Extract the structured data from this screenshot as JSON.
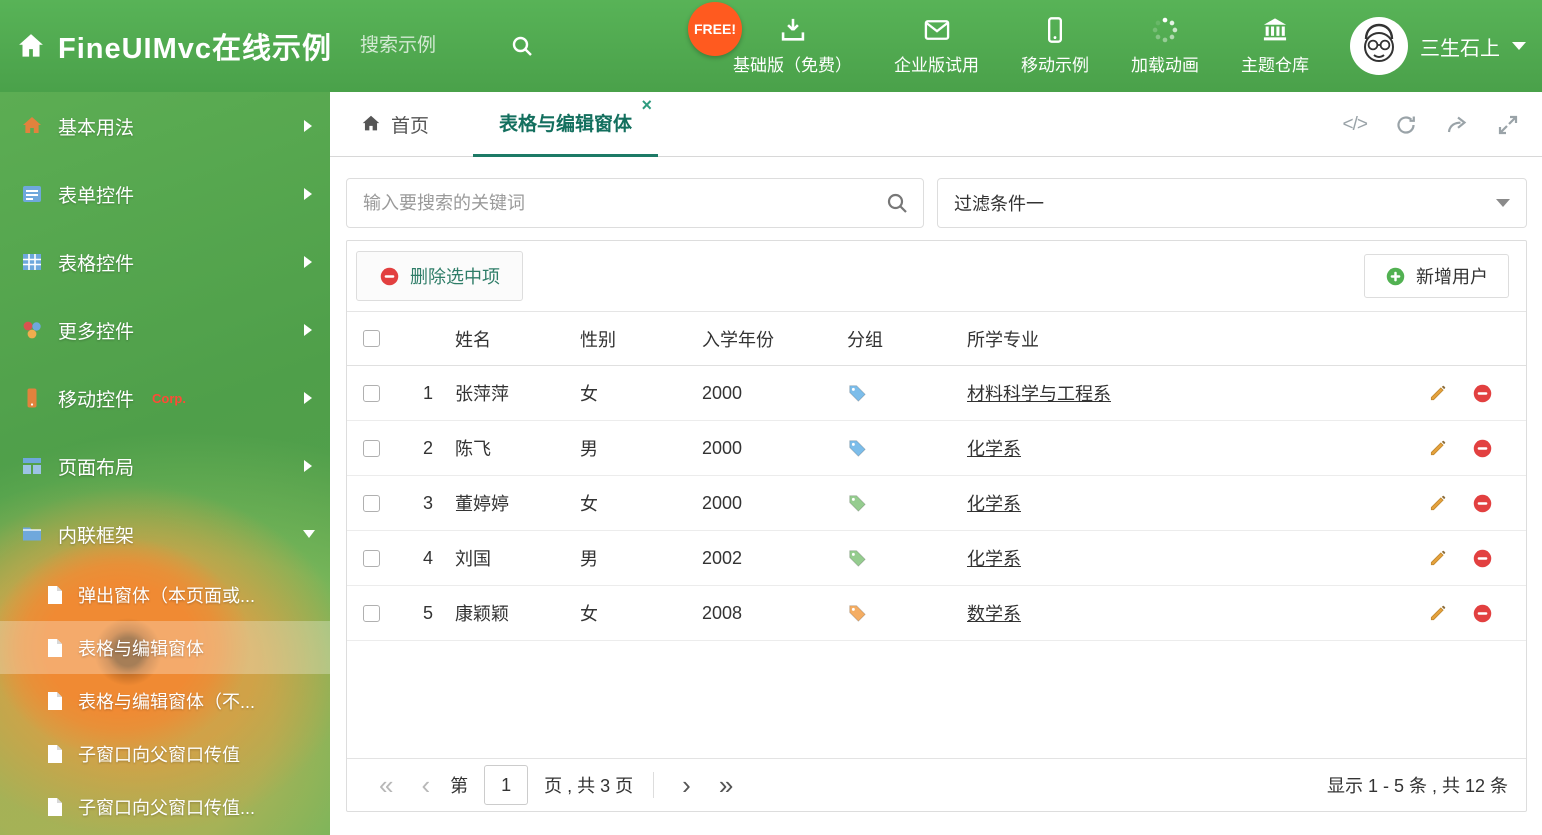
{
  "colors": {
    "header_green": "#52a952",
    "tab_accent": "#1d7a66",
    "free_badge": "#ff5a1f",
    "delete_red": "#e24040",
    "add_green": "#52b152",
    "pencil_orange": "#e6a23c",
    "tag_blue": "#7cbdea",
    "tag_green": "#95cc8f",
    "tag_orange": "#f4ad63"
  },
  "icons": {
    "close_tab": "×",
    "code": "</>",
    "pager_first": "«",
    "pager_prev": "‹",
    "pager_next": "›",
    "pager_last": "»"
  },
  "header": {
    "title": "FineUIMvc在线示例",
    "search_placeholder": "搜索示例",
    "free_badge": "FREE!",
    "nav": [
      {
        "label": "基础版（免费）",
        "icon": "download-icon"
      },
      {
        "label": "企业版试用",
        "icon": "envelope-icon"
      },
      {
        "label": "移动示例",
        "icon": "mobile-icon"
      },
      {
        "label": "加载动画",
        "icon": "spinner-icon"
      },
      {
        "label": "主题仓库",
        "icon": "bank-icon"
      }
    ],
    "user_name": "三生石上"
  },
  "sidebar": {
    "items": [
      {
        "label": "基本用法",
        "icon": "home-icon"
      },
      {
        "label": "表单控件",
        "icon": "form-icon"
      },
      {
        "label": "表格控件",
        "icon": "table-icon"
      },
      {
        "label": "更多控件",
        "icon": "widgets-icon"
      },
      {
        "label": "移动控件",
        "icon": "mobile-icon",
        "badge": "Corp."
      },
      {
        "label": "页面布局",
        "icon": "layout-icon"
      },
      {
        "label": "内联框架",
        "icon": "folder-icon",
        "expanded": true
      }
    ],
    "subitems": [
      {
        "label": "弹出窗体（本页面或..."
      },
      {
        "label": "表格与编辑窗体",
        "active": true
      },
      {
        "label": "表格与编辑窗体（不..."
      },
      {
        "label": "子窗口向父窗口传值"
      },
      {
        "label": "子窗口向父窗口传值..."
      }
    ]
  },
  "tabs": {
    "home_label": "首页",
    "active_label": "表格与编辑窗体"
  },
  "filter": {
    "search_placeholder": "输入要搜索的关键词",
    "select_value": "过滤条件一"
  },
  "toolbar": {
    "delete_label": "删除选中项",
    "add_label": "新增用户"
  },
  "table": {
    "headers": [
      "姓名",
      "性别",
      "入学年份",
      "分组",
      "所学专业"
    ],
    "rows": [
      {
        "num": "1",
        "name": "张萍萍",
        "gender": "女",
        "year": "2000",
        "tag": "#7cbdea",
        "major": "材料科学与工程系"
      },
      {
        "num": "2",
        "name": "陈飞",
        "gender": "男",
        "year": "2000",
        "tag": "#7cbdea",
        "major": "化学系"
      },
      {
        "num": "3",
        "name": "董婷婷",
        "gender": "女",
        "year": "2000",
        "tag": "#95cc8f",
        "major": "化学系"
      },
      {
        "num": "4",
        "name": "刘国",
        "gender": "男",
        "year": "2002",
        "tag": "#95cc8f",
        "major": "化学系"
      },
      {
        "num": "5",
        "name": "康颖颖",
        "gender": "女",
        "year": "2008",
        "tag": "#f4ad63",
        "major": "数学系"
      }
    ]
  },
  "pagination": {
    "page_prefix": "第",
    "current_page": "1",
    "page_suffix": "页 , 共 3 页",
    "summary": "显示 1 - 5 条 , 共 12 条"
  }
}
